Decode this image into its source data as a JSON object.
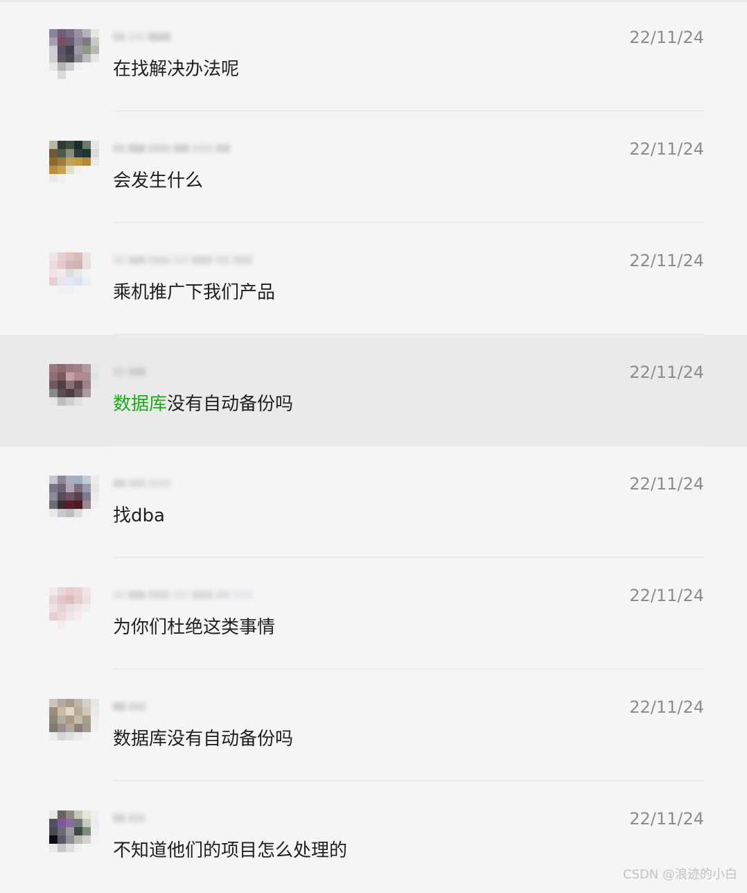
{
  "chats": [
    {
      "preview": "在找解决办法呢",
      "date": "22/11/24",
      "highlight_prefix": "",
      "selected": false,
      "avatar": [
        "#8e8294",
        "#6d5f7a",
        "#7c6d86",
        "#9a90a6",
        "#b8b2c0",
        "#e6e6e6",
        "#a89bb4",
        "#7a4f5f",
        "#6a5a72",
        "#8f8a97",
        "#7e7a82",
        "#c9c9c9",
        "#d0ccd6",
        "#585168",
        "#45404d",
        "#9f9aa6",
        "#8b9a87",
        "#b7b7b7",
        "#cfcfcf",
        "#5d5a60",
        "#4d4a52",
        "#8e8a92",
        "#bdbabf",
        "#e6e6e6",
        "#e6e6e6",
        "#b5b2b8",
        "#cfcdd2",
        "#f0f0f0",
        "#f5f5f5",
        "#f5f5f5",
        "#f5f5f5",
        "#d9d9d9",
        "#f5f5f5",
        "#f5f5f5",
        "#f5f5f5",
        "#f5f5f5"
      ],
      "name_blur": [
        "#d7d7d7",
        "#e3e3e3",
        "#d0d0d0"
      ]
    },
    {
      "preview": "会发生什么",
      "date": "22/11/24",
      "highlight_prefix": "",
      "selected": false,
      "avatar": [
        "#b9b6a6",
        "#2f3b32",
        "#3d4f44",
        "#1a2e2a",
        "#6d7a6a",
        "#e6e6e6",
        "#6c5a3a",
        "#4b5a4a",
        "#8c8c7a",
        "#2b3b3a",
        "#1f3331",
        "#d9d9d9",
        "#8a6a2e",
        "#9b7c3a",
        "#c1a25a",
        "#c49a3e",
        "#b08a3a",
        "#e9e9e9",
        "#b78c3c",
        "#c6a24e",
        "#e3dccb",
        "#efefef",
        "#f5f5f5",
        "#f5f5f5",
        "#e9e9e9",
        "#f0f0f0",
        "#f5f5f5",
        "#f5f5f5",
        "#f5f5f5",
        "#f5f5f5",
        "#f5f5f5",
        "#f5f5f5",
        "#f5f5f5",
        "#f5f5f5",
        "#f5f5f5",
        "#f5f5f5"
      ],
      "name_blur": [
        "#d9d9d9",
        "#cfcfcf",
        "#dadada",
        "#d2d2d2",
        "#e0e0e0",
        "#d4d4d4"
      ]
    },
    {
      "preview": "乘机推广下我们产品",
      "date": "22/11/24",
      "highlight_prefix": "",
      "selected": false,
      "avatar": [
        "#f0e6e6",
        "#e8cfcf",
        "#e0c4c4",
        "#d9bcbc",
        "#ece3e3",
        "#f5f5f5",
        "#eed9dc",
        "#e5c8cc",
        "#d6b7b9",
        "#cfb4b4",
        "#e9e0e0",
        "#f5f5f5",
        "#f3e3e7",
        "#f4e9ec",
        "#dedede",
        "#eaeaea",
        "#f3f3f3",
        "#f5f5f5",
        "#e8cfd2",
        "#e6e6ec",
        "#e2e8f4",
        "#dce4f1",
        "#eaeef5",
        "#f5f5f5",
        "#f5f5f5",
        "#f1f1f4",
        "#eef0f6",
        "#f5f5f5",
        "#f5f5f5",
        "#f5f5f5",
        "#f5f5f5",
        "#f5f5f5",
        "#f5f5f5",
        "#f5f5f5",
        "#f5f5f5",
        "#f5f5f5"
      ],
      "name_blur": [
        "#e2e2e2",
        "#d6d6d6",
        "#dedede",
        "#e4e4e4",
        "#d8d8d8",
        "#e0e0e0",
        "#dbdbdb"
      ]
    },
    {
      "preview": "数据库没有自动备份吗",
      "date": "22/11/24",
      "highlight_prefix": "数据库",
      "selected": true,
      "avatar": [
        "#9c7a7c",
        "#8f6b6f",
        "#a07a7f",
        "#9f8288",
        "#b59aa0",
        "#e6e6e6",
        "#8d6e72",
        "#7a5a5f",
        "#c4a3a8",
        "#b08a90",
        "#a98c92",
        "#e3e3e3",
        "#6f5a60",
        "#4f3e44",
        "#8a7076",
        "#5f4a50",
        "#9c8288",
        "#e8e8e8",
        "#8a8a8a",
        "#5a4e54",
        "#4a3d43",
        "#6e5d63",
        "#a79ca0",
        "#ebebeb",
        "#e6e6e6",
        "#bdbdbd",
        "#cfcfcf",
        "#e0e0e0",
        "#eaeaea",
        "#eaeaea",
        "#eaeaea",
        "#eaeaea",
        "#eaeaea",
        "#eaeaea",
        "#eaeaea",
        "#eaeaea"
      ],
      "name_blur": [
        "#d9d9d9",
        "#cfcfcf"
      ]
    },
    {
      "preview": "找dba",
      "date": "22/11/24",
      "highlight_prefix": "",
      "selected": false,
      "avatar": [
        "#c7c7cf",
        "#8a8898",
        "#a9aebe",
        "#9eb2c4",
        "#c4ccd8",
        "#ececec",
        "#7a7488",
        "#6f6278",
        "#b2a4b4",
        "#7d6d80",
        "#9a9aa8",
        "#e6e6e6",
        "#8c8a96",
        "#5a4a5a",
        "#6e5266",
        "#5c3e4c",
        "#7b7b8b",
        "#ebebeb",
        "#6e6e7a",
        "#3a2a33",
        "#5a1e2a",
        "#4a1a24",
        "#9a8a90",
        "#f0f0f0",
        "#e9e9e9",
        "#c9c9cf",
        "#bdbdc2",
        "#dcdcdc",
        "#f2f2f2",
        "#f5f5f5",
        "#f5f5f5",
        "#f5f5f5",
        "#f5f5f5",
        "#f5f5f5",
        "#f5f5f5",
        "#f5f5f5"
      ],
      "name_blur": [
        "#d6d6d6",
        "#dcdcdc",
        "#e2e2e2"
      ]
    },
    {
      "preview": "为你们杜绝这类事情",
      "date": "22/11/24",
      "highlight_prefix": "",
      "selected": false,
      "avatar": [
        "#f2eaea",
        "#ead6d6",
        "#e6cccc",
        "#e9d2d2",
        "#f0e6e6",
        "#f5f5f5",
        "#ecd7d8",
        "#e2c4c6",
        "#dcbcbe",
        "#e5cfd0",
        "#ece0e1",
        "#f5f5f5",
        "#f1e2e4",
        "#e6d2d4",
        "#e9dfe0",
        "#efe7e8",
        "#f3eeee",
        "#f5f5f5",
        "#e6cfd2",
        "#ead8da",
        "#f0e6e8",
        "#f3eded",
        "#f5f5f5",
        "#f5f5f5",
        "#f5f5f5",
        "#f2eeee",
        "#f5f5f5",
        "#f5f5f5",
        "#f5f5f5",
        "#f5f5f5",
        "#f5f5f5",
        "#f5f5f5",
        "#f5f5f5",
        "#f5f5f5",
        "#f5f5f5",
        "#f5f5f5"
      ],
      "name_blur": [
        "#e4e4e4",
        "#d6d6d6",
        "#dcdcdc",
        "#e6e6e6",
        "#dadada",
        "#e0e0e0",
        "#e8e8ee"
      ]
    },
    {
      "preview": "数据库没有自动备份吗",
      "date": "22/11/24",
      "highlight_prefix": "",
      "selected": false,
      "avatar": [
        "#c8c4c0",
        "#b5aaa0",
        "#a89c90",
        "#c0b6ac",
        "#d6d0ca",
        "#e6e6e6",
        "#9a8c7c",
        "#cbbca6",
        "#e3d8c6",
        "#b8a994",
        "#d2c6b6",
        "#e9e9e9",
        "#8c8678",
        "#b6ac9c",
        "#a89a86",
        "#c6baa8",
        "#a89c8c",
        "#eeeeee",
        "#7c7a72",
        "#98908a",
        "#b2aa9e",
        "#8a8478",
        "#a09a92",
        "#f0f0f0",
        "#ececec",
        "#d6d6d6",
        "#e0e0e0",
        "#eaeaea",
        "#f2f2f2",
        "#f5f5f5",
        "#f5f5f5",
        "#f5f5f5",
        "#f5f5f5",
        "#f5f5f5",
        "#f5f5f5",
        "#f5f5f5"
      ],
      "name_blur": [
        "#cfcfcf",
        "#d9d9d9"
      ]
    },
    {
      "preview": "不知道他们的项目怎么处理的",
      "date": "22/11/24",
      "highlight_prefix": "",
      "selected": false,
      "avatar": [
        "#e6e6e6",
        "#6a6458",
        "#8e8a82",
        "#c8c8b8",
        "#e4e8d8",
        "#f0f0f0",
        "#5a4e66",
        "#7a5a9a",
        "#8a6aa4",
        "#6e7a72",
        "#c8ccc0",
        "#ececec",
        "#4a4a52",
        "#6a6a74",
        "#9a9aa2",
        "#3e4a44",
        "#7a8a7e",
        "#eeeeee",
        "#0e0e12",
        "#5a5a62",
        "#8e8e96",
        "#b6bab2",
        "#d2d4cc",
        "#f2f2f2",
        "#e9e9e9",
        "#c6c6c8",
        "#dedede",
        "#efefef",
        "#f5f5f5",
        "#f5f5f5",
        "#f5f5f5",
        "#f5f5f5",
        "#f5f5f5",
        "#f5f5f5",
        "#f5f5f5",
        "#f5f5f5"
      ],
      "name_blur": [
        "#d4d4d4",
        "#dcdcdc"
      ]
    }
  ],
  "watermark": "CSDN @浪迹的小白",
  "colors": {
    "highlight_green": "#1aad19",
    "selected_row_bg": "#eaeaea"
  }
}
